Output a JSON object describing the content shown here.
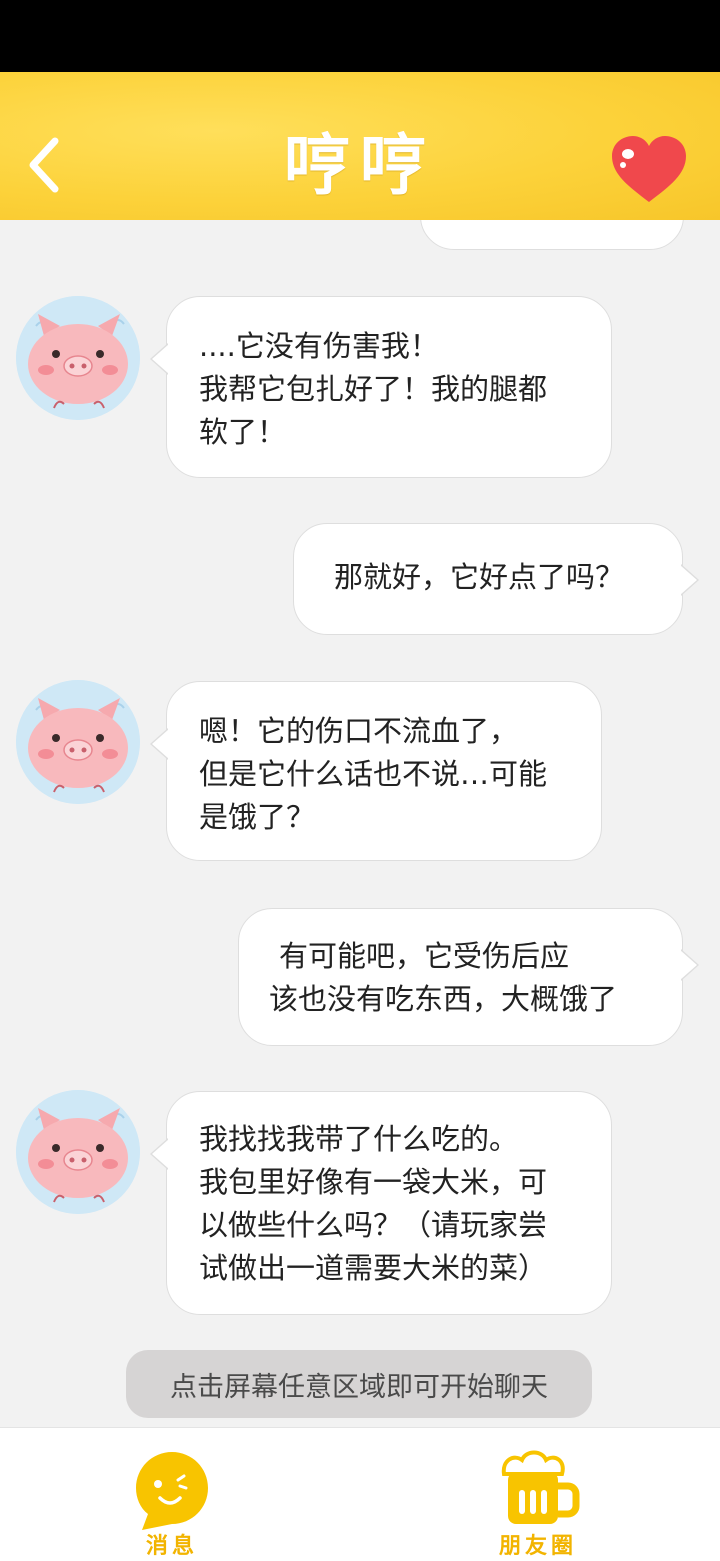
{
  "header": {
    "title": "哼哼"
  },
  "messages": [
    {
      "side": "left",
      "sender": "pig",
      "lines": [
        "....它没有伤害我！",
        "我帮它包扎好了！我的腿都",
        "软了！"
      ]
    },
    {
      "side": "right",
      "sender": "player",
      "lines": [
        "那就好，它好点了吗？"
      ]
    },
    {
      "side": "left",
      "sender": "pig",
      "lines": [
        "嗯！它的伤口不流血了，",
        "但是它什么话也不说…可能",
        "是饿了？"
      ]
    },
    {
      "side": "right",
      "sender": "player",
      "lines": [
        "有可能吧，它受伤后应",
        "该也没有吃东西，大概饿了"
      ]
    },
    {
      "side": "left",
      "sender": "pig",
      "lines": [
        "我找找我带了什么吃的。",
        "我包里好像有一袋大米，可",
        "以做些什么吗？（请玩家尝",
        "试做出一道需要大米的菜）"
      ]
    }
  ],
  "hint": "点击屏幕任意区域即可开始聊天",
  "tabs": [
    {
      "label": "消息",
      "icon": "chat-bubble-icon"
    },
    {
      "label": "朋友圈",
      "icon": "beer-mug-icon"
    }
  ],
  "colors": {
    "header_yellow": "#fcd23a",
    "accent_yellow": "#f2b400",
    "heart_red": "#f0484c",
    "pig_pink": "#f8b9bd",
    "avatar_blue": "#cfe8f6"
  }
}
